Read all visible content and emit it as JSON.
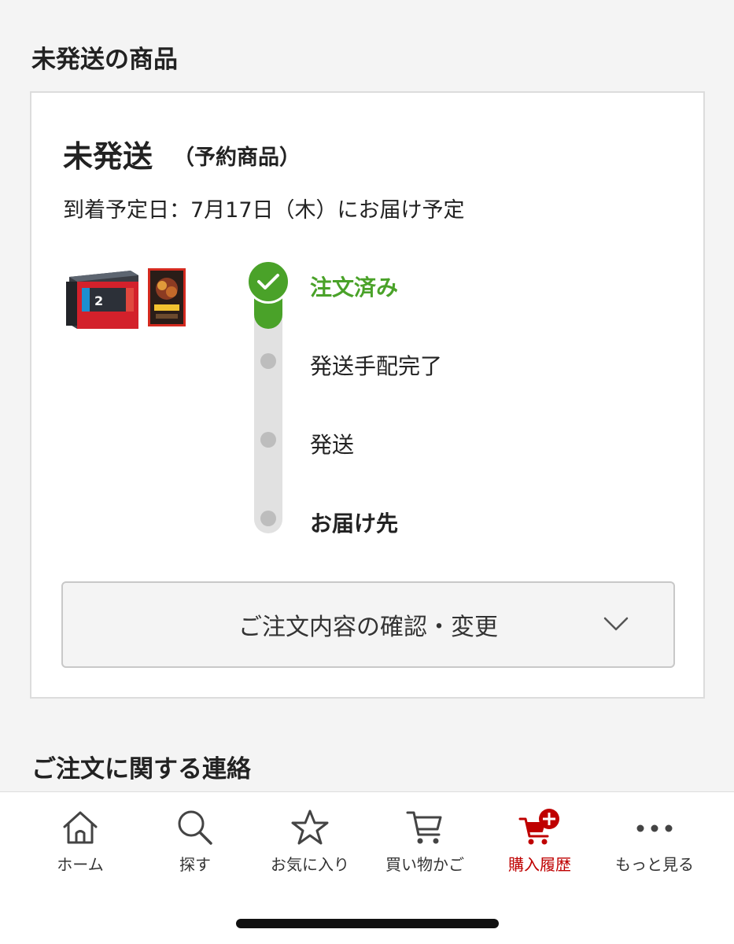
{
  "sections": {
    "unshipped_heading": "未発送の商品",
    "contact_heading": "ご注文に関する連絡"
  },
  "order": {
    "status": "未発送",
    "status_note": "（予約商品）",
    "arrival": "到着予定日：7月17日（木）にお届け予定",
    "steps": [
      {
        "label": "注文済み",
        "state": "done"
      },
      {
        "label": "発送手配完了",
        "state": "pending"
      },
      {
        "label": "発送",
        "state": "pending"
      },
      {
        "label": "お届け先",
        "state": "pending"
      }
    ],
    "details_button": "ご注文内容の確認・変更"
  },
  "nav": {
    "items": [
      {
        "label": "ホーム",
        "icon": "home-icon",
        "active": false
      },
      {
        "label": "探す",
        "icon": "search-icon",
        "active": false
      },
      {
        "label": "お気に入り",
        "icon": "star-icon",
        "active": false
      },
      {
        "label": "買い物かご",
        "icon": "cart-icon",
        "active": false
      },
      {
        "label": "購入履歴",
        "icon": "cart-history-icon",
        "active": true
      },
      {
        "label": "もっと見る",
        "icon": "more-dots-icon",
        "active": false
      }
    ]
  },
  "colors": {
    "accent_green": "#4aa229",
    "active_red": "#bf0000",
    "pending_gray": "#bdbdbd"
  }
}
